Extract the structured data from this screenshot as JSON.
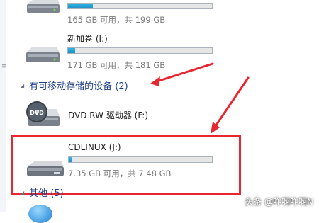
{
  "drives": [
    {
      "name": "",
      "free_text": "165 GB 可用，共 199 GB",
      "used_fraction": 0.17,
      "icon": "hard-drive-icon"
    },
    {
      "name": "新加卷 (I:)",
      "free_text": "171 GB 可用，共 181 GB",
      "used_fraction": 0.05,
      "icon": "hard-drive-icon"
    }
  ],
  "removable_section": {
    "label": "有可移动存储的设备 (2)"
  },
  "removable": [
    {
      "name": "DVD RW 驱动器 (F:)",
      "icon": "dvd-drive-icon",
      "icon_label": "DVD"
    },
    {
      "name": "CDLINUX (J:)",
      "free_text": "7.35 GB 可用，共 7.48 GB",
      "used_fraction": 0.02,
      "icon": "usb-drive-icon"
    }
  ],
  "other_section": {
    "label": "其他 (5)"
  },
  "watermark": "头条 @咋啊咋啊N",
  "colors": {
    "accent_red": "#e8262f",
    "bar_fill": "#26a0da",
    "section_text": "#1e3f8a"
  }
}
